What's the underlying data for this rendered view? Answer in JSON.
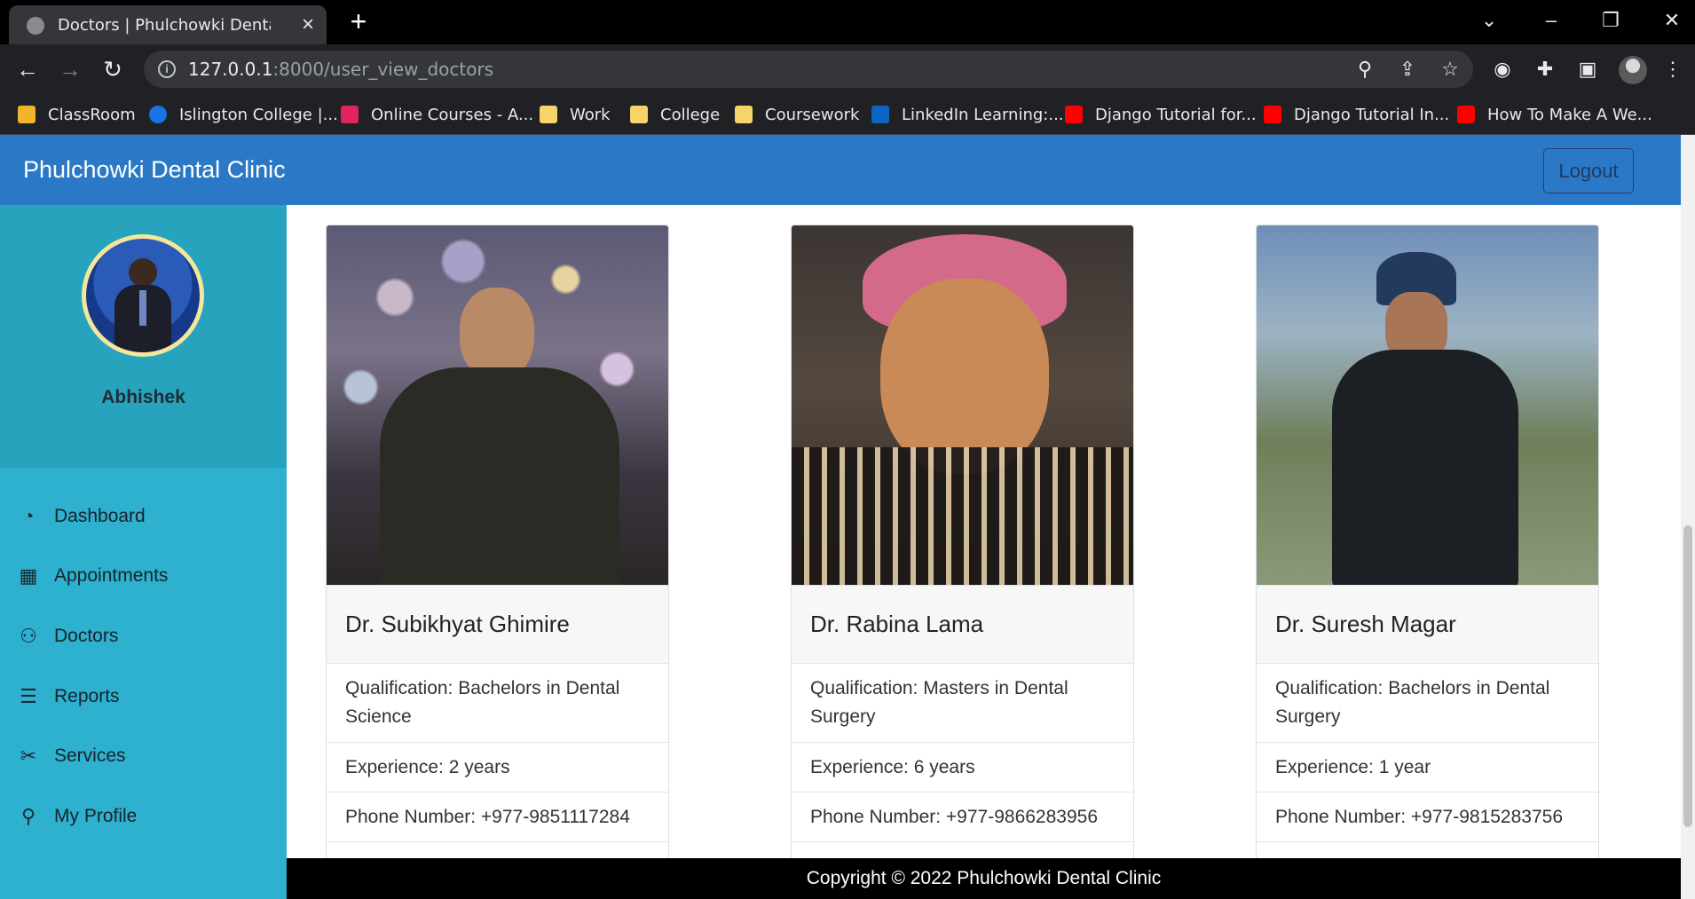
{
  "browser": {
    "tab_title": "Doctors | Phulchowki Dental Care",
    "url_host": "127.0.0.1",
    "url_path": ":8000/user_view_doctors",
    "bookmarks": [
      {
        "label": "ClassRoom",
        "color": "#f2b42a"
      },
      {
        "label": "Islington College |...",
        "color": "#1a73e8"
      },
      {
        "label": "Online Courses - A...",
        "color": "#e0245e"
      },
      {
        "label": "Work",
        "color": "#f6d36b"
      },
      {
        "label": "College",
        "color": "#f6d36b"
      },
      {
        "label": "Coursework",
        "color": "#f6d36b"
      },
      {
        "label": "LinkedIn Learning:...",
        "color": "#0a66c2"
      },
      {
        "label": "Django Tutorial for...",
        "color": "#ff0000"
      },
      {
        "label": "Django Tutorial In...",
        "color": "#ff0000"
      },
      {
        "label": "How To Make A We...",
        "color": "#ff0000"
      }
    ]
  },
  "navbar": {
    "brand": "Phulchowki Dental Clinic",
    "logout_label": "Logout"
  },
  "sidebar": {
    "username": "Abhishek",
    "items": [
      {
        "label": "Dashboard",
        "icon": "dashboard-icon"
      },
      {
        "label": "Appointments",
        "icon": "calendar-icon"
      },
      {
        "label": "Doctors",
        "icon": "people-icon"
      },
      {
        "label": "Reports",
        "icon": "report-icon"
      },
      {
        "label": "Services",
        "icon": "tools-icon"
      },
      {
        "label": "My Profile",
        "icon": "person-icon"
      }
    ]
  },
  "doctors": [
    {
      "name": "Dr. Subikhyat Ghimire",
      "qualification": "Qualification: Bachelors in Dental Science",
      "experience": "Experience: 2 years",
      "phone": "Phone Number: +977-9851117284"
    },
    {
      "name": "Dr. Rabina Lama",
      "qualification": "Qualification: Masters in Dental Surgery",
      "experience": "Experience: 6 years",
      "phone": "Phone Number: +977-9866283956"
    },
    {
      "name": "Dr. Suresh Magar",
      "qualification": "Qualification: Bachelors in Dental Surgery",
      "experience": "Experience: 1 year",
      "phone": "Phone Number: +977-9815283756"
    }
  ],
  "footer": {
    "text": "Copyright © 2022 Phulchowki Dental Clinic"
  },
  "colors": {
    "navbar": "#2b79c6",
    "sidebar": "#2eb0cf",
    "profile_box": "#27a3bd",
    "footer": "#000000"
  }
}
